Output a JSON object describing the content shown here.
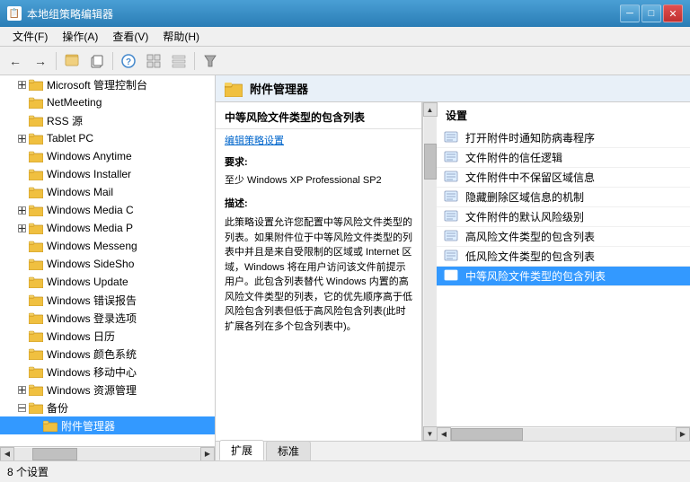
{
  "titleBar": {
    "title": "本地组策略编辑器",
    "minBtn": "─",
    "maxBtn": "□",
    "closeBtn": "✕"
  },
  "menuBar": {
    "items": [
      {
        "label": "文件(F)"
      },
      {
        "label": "操作(A)"
      },
      {
        "label": "查看(V)"
      },
      {
        "label": "帮助(H)"
      }
    ]
  },
  "toolbar": {
    "buttons": [
      "←",
      "→",
      "⬆",
      "📋",
      "📋",
      "⊕",
      "📋",
      "📋",
      "🔽"
    ]
  },
  "leftPanel": {
    "treeItems": [
      {
        "id": "microsoft",
        "label": "Microsoft 管理控制台",
        "indent": 1,
        "hasExpander": true,
        "expanded": false
      },
      {
        "id": "netmeeting",
        "label": "NetMeeting",
        "indent": 1,
        "hasExpander": false
      },
      {
        "id": "rss",
        "label": "RSS 源",
        "indent": 1,
        "hasExpander": false
      },
      {
        "id": "tablet",
        "label": "Tablet PC",
        "indent": 1,
        "hasExpander": true,
        "expanded": false
      },
      {
        "id": "winAnytime",
        "label": "Windows Anytime",
        "indent": 1,
        "hasExpander": false
      },
      {
        "id": "winInstaller",
        "label": "Windows Installer",
        "indent": 1,
        "hasExpander": false
      },
      {
        "id": "winMail",
        "label": "Windows Mail",
        "indent": 1,
        "hasExpander": false
      },
      {
        "id": "winMediaC",
        "label": "Windows Media C",
        "indent": 1,
        "hasExpander": true,
        "expanded": false
      },
      {
        "id": "winMediaP",
        "label": "Windows Media P",
        "indent": 1,
        "hasExpander": true,
        "expanded": false
      },
      {
        "id": "winMessenger",
        "label": "Windows Messeng",
        "indent": 1,
        "hasExpander": false
      },
      {
        "id": "winSideShow",
        "label": "Windows SideSho",
        "indent": 1,
        "hasExpander": false
      },
      {
        "id": "winUpdate",
        "label": "Windows Update",
        "indent": 1,
        "hasExpander": false
      },
      {
        "id": "winError",
        "label": "Windows 错误报告",
        "indent": 1,
        "hasExpander": false
      },
      {
        "id": "winLogin",
        "label": "Windows 登录选项",
        "indent": 1,
        "hasExpander": false
      },
      {
        "id": "winCalendar",
        "label": "Windows 日历",
        "indent": 1,
        "hasExpander": false
      },
      {
        "id": "winColor",
        "label": "Windows 颜色系统",
        "indent": 1,
        "hasExpander": false
      },
      {
        "id": "winMobile",
        "label": "Windows 移动中心",
        "indent": 1,
        "hasExpander": false
      },
      {
        "id": "winExplorer",
        "label": "Windows 资源管理",
        "indent": 1,
        "hasExpander": true,
        "expanded": false
      },
      {
        "id": "backup",
        "label": "备份",
        "indent": 1,
        "hasExpander": true,
        "expanded": true
      },
      {
        "id": "attachMgr",
        "label": "附件管理器",
        "indent": 2,
        "hasExpander": false,
        "selected": true
      }
    ]
  },
  "rightHeader": {
    "title": "附件管理器"
  },
  "policyPanel": {
    "title": "中等风险文件类型的包含列表",
    "editLinkText": "编辑策略设置",
    "requireLabel": "要求:",
    "requireContent": "至少 Windows XP Professional SP2",
    "descLabel": "描述:",
    "descContent": "此策略设置允许您配置中等风险文件类型的列表。如果附件位于中等风险文件类型的列表中并且是来自受限制的区域或 Internet 区域，Windows 将在用户访问该文件前提示用户。此包含列表替代 Windows 内置的高风险文件类型的列表，它的优先顺序高于低风险包含列表但低于高风险包含列表(此时扩展各列在多个包含列表中)。"
  },
  "settingsPanel": {
    "header": "设置",
    "items": [
      {
        "label": "打开附件时通知防病毒程序"
      },
      {
        "label": "文件附件的信任逻辑"
      },
      {
        "label": "文件附件中不保留区域信息"
      },
      {
        "label": "隐藏删除区域信息的机制"
      },
      {
        "label": "文件附件的默认风险级别"
      },
      {
        "label": "高风险文件类型的包含列表"
      },
      {
        "label": "低风险文件类型的包含列表"
      },
      {
        "label": "中等风险文件类型的包含列表",
        "selected": true
      }
    ]
  },
  "tabs": [
    {
      "label": "扩展",
      "active": true
    },
    {
      "label": "标准",
      "active": false
    }
  ],
  "statusBar": {
    "text": "8 个设置"
  }
}
